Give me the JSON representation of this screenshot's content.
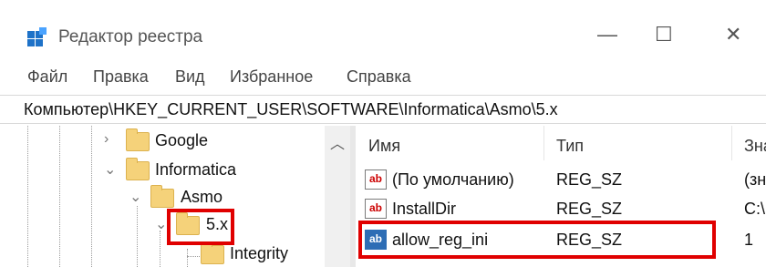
{
  "window": {
    "title": "Редактор реестра",
    "controls": {
      "minimize": "—",
      "maximize": "☐",
      "close": "✕"
    }
  },
  "menu": [
    "Файл",
    "Правка",
    "Вид",
    "Избранное",
    "Справка"
  ],
  "address": "Компьютер\\HKEY_CURRENT_USER\\SOFTWARE\\Informatica\\Asmo\\5.x",
  "tree": {
    "nodes": [
      {
        "label": "Google",
        "chevron": "›"
      },
      {
        "label": "Informatica",
        "chevron": "⌄"
      },
      {
        "label": "Asmo",
        "chevron": "⌄"
      },
      {
        "label": "5.x",
        "chevron": "⌄"
      },
      {
        "label": "Integrity",
        "chevron": ""
      }
    ],
    "scroll_up": "︿"
  },
  "list": {
    "columns": [
      "Имя",
      "Тип",
      "Зна"
    ],
    "rows": [
      {
        "icon": "ab",
        "name": "(По умолчанию)",
        "type": "REG_SZ",
        "value": "(зн"
      },
      {
        "icon": "ab",
        "name": "InstallDir",
        "type": "REG_SZ",
        "value": "C:\\"
      },
      {
        "icon": "ab",
        "name": "allow_reg_ini",
        "type": "REG_SZ",
        "value": "1"
      }
    ]
  },
  "colors": {
    "highlight": "#e00000",
    "folder": "#f5d27a",
    "selected_icon": "#2d6db5"
  }
}
